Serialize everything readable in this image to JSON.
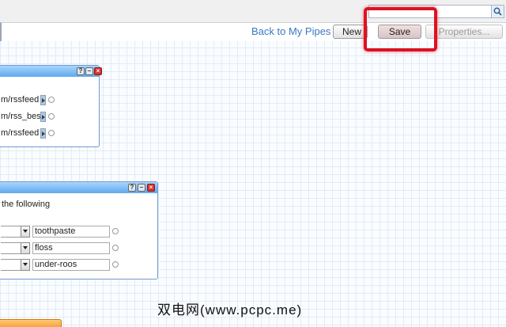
{
  "toolbar": {
    "back_link": "Back to My Pipes",
    "new_label": "New",
    "save_label": "Save",
    "properties_label": "Properties..."
  },
  "search": {
    "value": ""
  },
  "fetch_module": {
    "feeds": [
      "m/rssfeed",
      "m/rss_best",
      "m/rssfeed"
    ]
  },
  "filter_module": {
    "description": "the following",
    "rules": [
      "toothpaste",
      "floss",
      "under-roos"
    ]
  },
  "watermark": "双电网(www.pcpc.me)",
  "colors": {
    "highlight": "#e01020",
    "link": "#3a7ac3",
    "module_title": "#5fa8ee"
  }
}
